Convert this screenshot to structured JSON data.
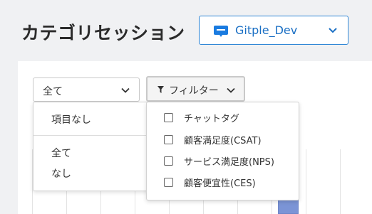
{
  "header": {
    "title": "カテゴリセッション",
    "workspace": {
      "label": "Gitple_Dev",
      "icon": "chat-screen-icon",
      "accent_color": "#2f86d6"
    }
  },
  "controls": {
    "category_select": {
      "value": "全て",
      "icon": "chevron-down-icon"
    },
    "filter_button": {
      "label": "フィルター",
      "icon": "funnel-icon"
    }
  },
  "category_menu": {
    "items": [
      "項目なし",
      "全て",
      "なし"
    ]
  },
  "filter_menu": {
    "options": [
      {
        "label": "チャットタグ",
        "checked": false
      },
      {
        "label": "顧客満足度(CSAT)",
        "checked": false
      },
      {
        "label": "サービス満足度(NPS)",
        "checked": false
      },
      {
        "label": "顧客便宜性(CES)",
        "checked": false
      }
    ]
  },
  "colors": {
    "bar": "#7b94d6",
    "background": "#f0f1f3"
  }
}
